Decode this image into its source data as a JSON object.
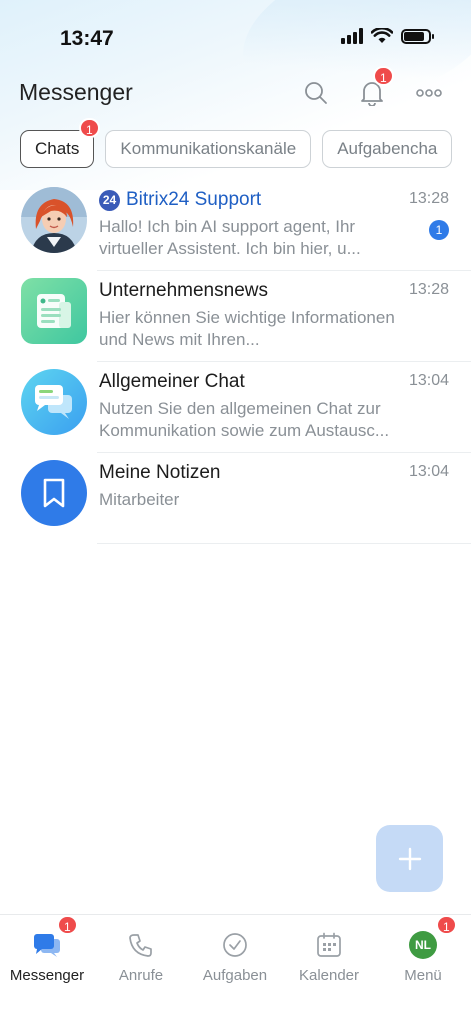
{
  "status": {
    "time": "13:47"
  },
  "header": {
    "title": "Messenger",
    "notifications_badge": "1"
  },
  "tabs": [
    {
      "label": "Chats",
      "badge": "1",
      "active": true
    },
    {
      "label": "Kommunikationskanäle",
      "active": false
    },
    {
      "label": "Aufgabencha",
      "active": false
    }
  ],
  "chats": [
    {
      "name": "Bitrix24 Support",
      "prefix_badge": "24",
      "time": "13:28",
      "preview": "Hallo! Ich bin AI support agent, Ihr virtueller Assistent. Ich bin hier, u...",
      "unread": "1"
    },
    {
      "name": "Unternehmensnews",
      "time": "13:28",
      "preview": "Hier können Sie wichtige Informationen und News mit Ihren..."
    },
    {
      "name": "Allgemeiner Chat",
      "time": "13:04",
      "preview": "Nutzen Sie den allgemeinen Chat zur Kommunikation sowie zum Austausc..."
    },
    {
      "name": "Meine Notizen",
      "time": "13:04",
      "preview": "Mitarbeiter"
    }
  ],
  "bottom_nav": [
    {
      "label": "Messenger",
      "badge": "1",
      "active": true,
      "icon": "messenger-icon"
    },
    {
      "label": "Anrufe",
      "icon": "phone-icon"
    },
    {
      "label": "Aufgaben",
      "icon": "check-circle-icon"
    },
    {
      "label": "Kalender",
      "icon": "calendar-icon"
    },
    {
      "label": "Menü",
      "badge": "1",
      "avatar_initials": "NL",
      "icon": "avatar"
    }
  ],
  "colors": {
    "accent": "#2f7be8",
    "badge": "#ef4b4b",
    "support_title": "#1f5fc4",
    "avatar_green": "#3f9b42"
  }
}
